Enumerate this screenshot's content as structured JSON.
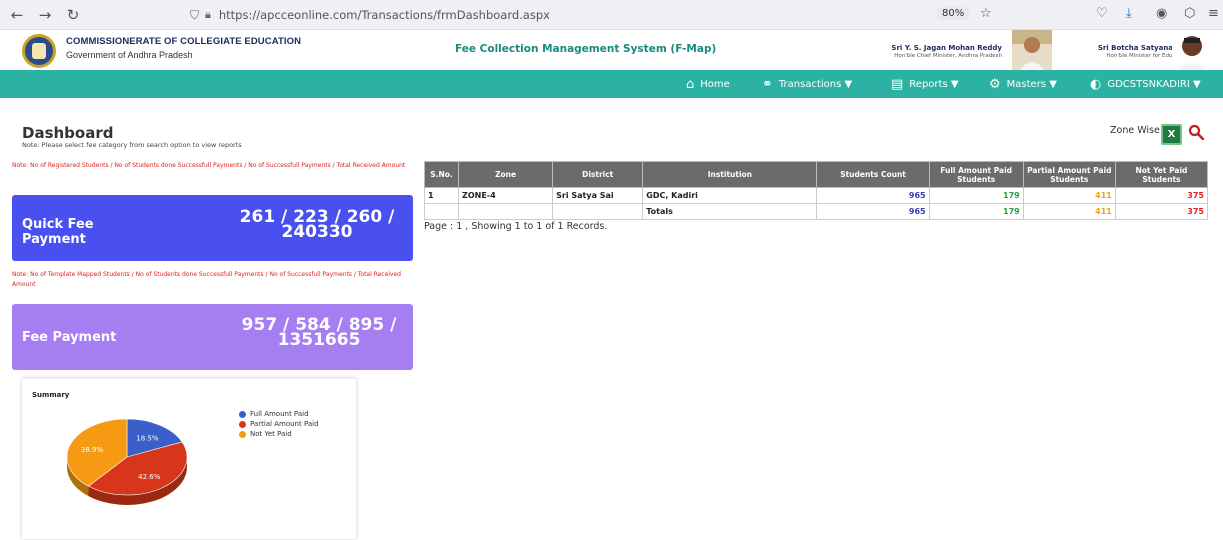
{
  "browser": {
    "url": "https://apcceonline.com/Transactions/frmDashboard.aspx",
    "zoom": "80%"
  },
  "header": {
    "org_title": "COMMISSIONERATE OF COLLEGIATE EDUCATION",
    "org_sub": "Government of Andhra Pradesh",
    "system_title": "Fee Collection Management System (F-Map)",
    "person1_name": "Sri Y. S. Jagan Mohan Reddy",
    "person1_role": "Hon'ble Chief Minister, Andhra Pradesh",
    "person2_name": "Sri Botcha Satyanarayana",
    "person2_role": "Hon'ble Minister for Education, AP"
  },
  "nav": {
    "home": "Home",
    "transactions": "Transactions ▼",
    "reports": "Reports ▼",
    "masters": "Masters ▼",
    "user": "GDCSTSNKADIRI ▼"
  },
  "dashboard": {
    "title": "Dashboard",
    "note": "Note: Please select fee category from search option to view reports",
    "note_quick": "Note: No of Registered Students / No of Students done Successfull Payments / No of Successfull Payments / Total Received Amount",
    "note_fee": "Note: No of Template Mapped Students / No of Students done Successfull Payments / No of Successfull Payments / Total Received Amount",
    "quick_label": "Quick Fee Payment",
    "quick_value_l1": "261 / 223 / 260 /",
    "quick_value_l2": "240330",
    "fee_label": "Fee Payment",
    "fee_value_l1": "957 / 584 / 895 /",
    "fee_value_l2": "1351665",
    "zone_wise": "Zone Wise",
    "colors": {
      "quick_card": "#4a4ff0",
      "fee_card": "#a57ef2",
      "navbar": "#2bb2a3"
    }
  },
  "table": {
    "headers": [
      "S.No.",
      "Zone",
      "District",
      "Institution",
      "Students Count",
      "Full Amount Paid Students",
      "Partial Amount Paid Students",
      "Not Yet Paid Students"
    ],
    "rows": [
      [
        "1",
        "ZONE-4",
        "Sri Satya Sai",
        "GDC, Kadiri",
        "965",
        "179",
        "411",
        "375"
      ]
    ],
    "totals": [
      "",
      "",
      "",
      "Totals",
      "965",
      "179",
      "411",
      "375"
    ],
    "pager": "Page : 1 , Showing 1 to 1 of 1 Records."
  },
  "chart_data": {
    "type": "pie",
    "title": "Summary",
    "labels": [
      "Full Amount Paid",
      "Partial Amount Paid",
      "Not Yet Paid"
    ],
    "values": [
      18.5,
      42.6,
      38.9
    ],
    "value_labels": [
      "18.5%",
      "42.6%",
      "38.9%"
    ],
    "colors": [
      "#3a5fc8",
      "#d8361a",
      "#f59a12"
    ],
    "legend": "top-right"
  }
}
